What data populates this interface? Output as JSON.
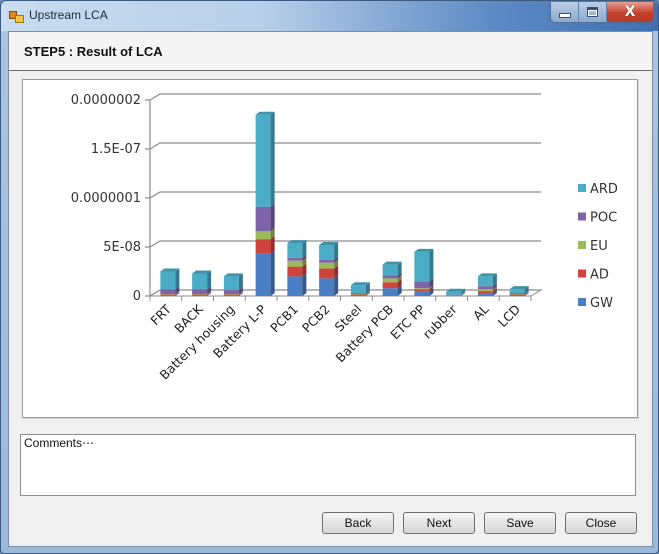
{
  "window": {
    "title": "Upstream LCA",
    "controls": {
      "minimize": "minimize",
      "maximize": "maximize",
      "close": "X"
    }
  },
  "header": {
    "title": "STEP5 : Result of LCA"
  },
  "comments": {
    "placeholder": "Comments⋯",
    "value": ""
  },
  "buttons": {
    "back": "Back",
    "next": "Next",
    "save": "Save",
    "close": "Close"
  },
  "colors": {
    "GW": "#4a7ec4",
    "AD": "#d2423c",
    "EU": "#9bbb59",
    "POC": "#7e63a8",
    "ARD": "#4bacc6"
  },
  "chart_data": {
    "type": "bar",
    "stacked": true,
    "style": "3d-column",
    "title": "",
    "xlabel": "",
    "ylabel": "",
    "ylim": [
      0,
      2e-07
    ],
    "yticks": [
      0,
      5e-08,
      1e-07,
      1.5e-07,
      2e-07
    ],
    "ytick_labels": [
      "0",
      "5E-08",
      "0.0000001",
      "1.5E-07",
      "0.0000002"
    ],
    "grid": true,
    "legend_position": "right",
    "legend_order": [
      "ARD",
      "POC",
      "EU",
      "AD",
      "GW"
    ],
    "categories": [
      "FRT",
      "BACK",
      "Battery housing",
      "Battery L-P",
      "PCB1",
      "PCB2",
      "Steel",
      "Battery PCB",
      "ETC PP",
      "rubber",
      "AL",
      "LCD"
    ],
    "series": [
      {
        "name": "GW",
        "values": [
          1e-09,
          1e-09,
          1e-09,
          4.3e-08,
          2e-08,
          1.8e-08,
          1e-09,
          8e-09,
          5e-09,
          5e-10,
          3e-09,
          1e-09
        ]
      },
      {
        "name": "AD",
        "values": [
          5e-10,
          5e-10,
          5e-10,
          1.5e-08,
          1e-08,
          1e-08,
          5e-10,
          6e-09,
          2e-09,
          2e-10,
          2e-09,
          5e-10
        ]
      },
      {
        "name": "EU",
        "values": [
          5e-10,
          5e-10,
          5e-10,
          8e-09,
          6e-09,
          6e-09,
          5e-10,
          4e-09,
          1e-09,
          2e-10,
          2e-09,
          5e-10
        ]
      },
      {
        "name": "POC",
        "values": [
          5e-09,
          5e-09,
          4e-09,
          2.5e-08,
          3e-09,
          3e-09,
          1e-09,
          3e-09,
          7e-09,
          5e-10,
          3e-09,
          1e-09
        ]
      },
      {
        "name": "ARD",
        "values": [
          1.8e-08,
          1.6e-08,
          1.4e-08,
          9.4e-08,
          1.5e-08,
          1.5e-08,
          8e-09,
          1.1e-08,
          3e-08,
          3e-09,
          1e-08,
          4e-09
        ]
      }
    ]
  }
}
